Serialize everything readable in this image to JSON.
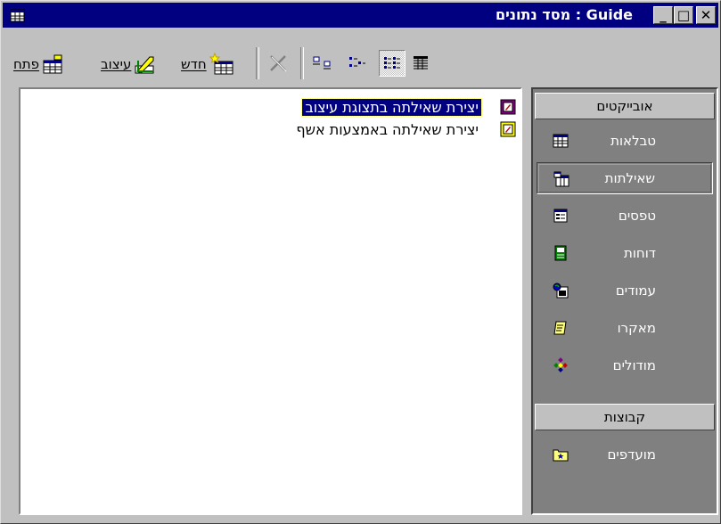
{
  "window": {
    "title": "מסד נתונים : Guide",
    "minimize_glyph": "_",
    "maximize_glyph": "□",
    "close_glyph": "✕"
  },
  "toolbar": {
    "open_label": "פתח",
    "design_label": "עיצוב",
    "new_label": "חדש"
  },
  "list": {
    "items": [
      {
        "label": "יצירת שאילתה בתצוגת עיצוב",
        "icon": "query-wizard-icon",
        "selected": true
      },
      {
        "label": "יצירת שאילתה באמצעות אשף",
        "icon": "query-wizard-icon",
        "selected": false
      }
    ]
  },
  "nav": {
    "objects_header": "אובייקטים",
    "groups_header": "קבוצות",
    "items": [
      {
        "label": "טבלאות",
        "icon": "table-icon"
      },
      {
        "label": "שאילתות",
        "icon": "query-icon",
        "active": true
      },
      {
        "label": "טפסים",
        "icon": "form-icon"
      },
      {
        "label": "דוחות",
        "icon": "report-icon"
      },
      {
        "label": "עמודים",
        "icon": "page-icon"
      },
      {
        "label": "מאקרו",
        "icon": "macro-icon"
      },
      {
        "label": "מודולים",
        "icon": "module-icon"
      }
    ],
    "group_items": [
      {
        "label": "מועדפים",
        "icon": "favorites-folder-icon"
      }
    ]
  },
  "colors": {
    "titlebar": "#000080",
    "face": "#c0c0c0",
    "nav_bg": "#808080",
    "selection": "#000080"
  }
}
